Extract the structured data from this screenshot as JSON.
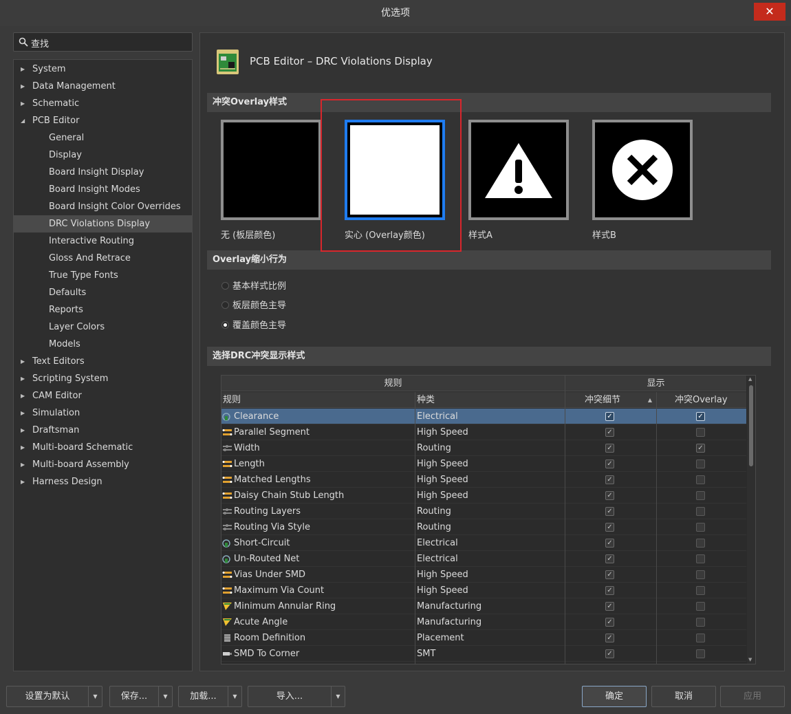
{
  "window": {
    "title": "优选项",
    "close": "✕"
  },
  "search": {
    "placeholder": "查找"
  },
  "tree": [
    {
      "label": "System",
      "expandable": true,
      "level": 0
    },
    {
      "label": "Data Management",
      "expandable": true,
      "level": 0
    },
    {
      "label": "Schematic",
      "expandable": true,
      "level": 0
    },
    {
      "label": "PCB Editor",
      "expandable": true,
      "expanded": true,
      "level": 0
    },
    {
      "label": "General",
      "level": 1
    },
    {
      "label": "Display",
      "level": 1
    },
    {
      "label": "Board Insight Display",
      "level": 1
    },
    {
      "label": "Board Insight Modes",
      "level": 1
    },
    {
      "label": "Board Insight Color Overrides",
      "level": 1
    },
    {
      "label": "DRC Violations Display",
      "level": 1,
      "selected": true
    },
    {
      "label": "Interactive Routing",
      "level": 1
    },
    {
      "label": "Gloss And Retrace",
      "level": 1
    },
    {
      "label": "True Type Fonts",
      "level": 1
    },
    {
      "label": "Defaults",
      "level": 1
    },
    {
      "label": "Reports",
      "level": 1
    },
    {
      "label": "Layer Colors",
      "level": 1
    },
    {
      "label": "Models",
      "level": 1
    },
    {
      "label": "Text Editors",
      "expandable": true,
      "level": 0
    },
    {
      "label": "Scripting System",
      "expandable": true,
      "level": 0
    },
    {
      "label": "CAM Editor",
      "expandable": true,
      "level": 0
    },
    {
      "label": "Simulation",
      "expandable": true,
      "level": 0
    },
    {
      "label": "Draftsman",
      "expandable": true,
      "level": 0
    },
    {
      "label": "Multi-board Schematic",
      "expandable": true,
      "level": 0
    },
    {
      "label": "Multi-board Assembly",
      "expandable": true,
      "level": 0
    },
    {
      "label": "Harness Design",
      "expandable": true,
      "level": 0
    }
  ],
  "page": {
    "title": "PCB Editor – DRC Violations Display",
    "overlay_section": "冲突Overlay样式",
    "overlay_styles": [
      {
        "label": "无 (板层颜色)",
        "kind": "none"
      },
      {
        "label": "实心 (Overlay颜色)",
        "kind": "solid",
        "selected": true
      },
      {
        "label": "样式A",
        "kind": "style-a"
      },
      {
        "label": "样式B",
        "kind": "style-b"
      }
    ],
    "shrink_section": "Overlay缩小行为",
    "shrink_options": [
      {
        "label": "基本样式比例",
        "checked": false
      },
      {
        "label": "板层颜色主导",
        "checked": false
      },
      {
        "label": "覆盖颜色主导",
        "checked": true
      }
    ],
    "drc_section": "选择DRC冲突显示样式"
  },
  "grid": {
    "group_headers": {
      "rules": "规则",
      "display": "显示"
    },
    "columns": {
      "rule": "规则",
      "kind": "种类",
      "detail": "冲突细节",
      "overlay": "冲突Overlay"
    },
    "rows": [
      {
        "rule": "Clearance",
        "kind": "Electrical",
        "icon": "electrical-icon",
        "detail": true,
        "overlay": true,
        "selected": true
      },
      {
        "rule": "Parallel Segment",
        "kind": "High Speed",
        "icon": "highspeed-icon",
        "detail": true,
        "overlay": false
      },
      {
        "rule": "Width",
        "kind": "Routing",
        "icon": "routing-icon",
        "detail": true,
        "overlay": true
      },
      {
        "rule": "Length",
        "kind": "High Speed",
        "icon": "highspeed-icon",
        "detail": true,
        "overlay": false
      },
      {
        "rule": "Matched Lengths",
        "kind": "High Speed",
        "icon": "highspeed-icon",
        "detail": true,
        "overlay": false
      },
      {
        "rule": "Daisy Chain Stub Length",
        "kind": "High Speed",
        "icon": "highspeed-icon",
        "detail": true,
        "overlay": false
      },
      {
        "rule": "Routing Layers",
        "kind": "Routing",
        "icon": "routing-icon",
        "detail": true,
        "overlay": false
      },
      {
        "rule": "Routing Via Style",
        "kind": "Routing",
        "icon": "routing-icon",
        "detail": true,
        "overlay": false
      },
      {
        "rule": "Short-Circuit",
        "kind": "Electrical",
        "icon": "electrical-icon",
        "detail": true,
        "overlay": false
      },
      {
        "rule": "Un-Routed Net",
        "kind": "Electrical",
        "icon": "electrical-icon",
        "detail": true,
        "overlay": false
      },
      {
        "rule": "Vias Under SMD",
        "kind": "High Speed",
        "icon": "highspeed-icon",
        "detail": true,
        "overlay": false
      },
      {
        "rule": "Maximum Via Count",
        "kind": "High Speed",
        "icon": "highspeed-icon",
        "detail": true,
        "overlay": false
      },
      {
        "rule": "Minimum Annular Ring",
        "kind": "Manufacturing",
        "icon": "manufacturing-icon",
        "detail": true,
        "overlay": false
      },
      {
        "rule": "Acute Angle",
        "kind": "Manufacturing",
        "icon": "manufacturing-icon",
        "detail": true,
        "overlay": false
      },
      {
        "rule": "Room Definition",
        "kind": "Placement",
        "icon": "placement-icon",
        "detail": true,
        "overlay": false
      },
      {
        "rule": "SMD To Corner",
        "kind": "SMT",
        "icon": "smt-icon",
        "detail": true,
        "overlay": false
      }
    ]
  },
  "buttons": {
    "set_default": "设置为默认",
    "save": "保存...",
    "load": "加载...",
    "import": "导入...",
    "ok": "确定",
    "cancel": "取消",
    "apply": "应用"
  },
  "colors": {
    "selection_blue": "#1f7cf0",
    "highlight_red": "#d9262c",
    "row_selected": "#4a6a8e"
  }
}
